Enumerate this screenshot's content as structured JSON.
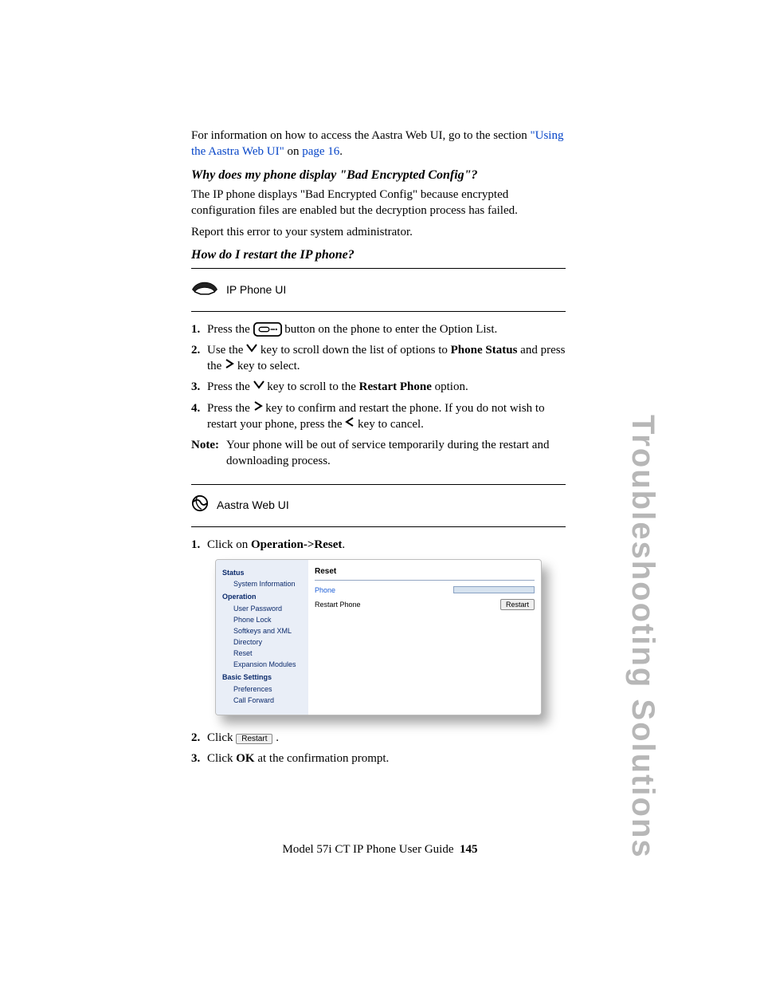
{
  "intro": {
    "text_before_link": "For information on how to access the Aastra Web UI, go to the section ",
    "link_text": "\"Using the Aastra Web UI\"",
    "page_ref_text": " on ",
    "page_ref_link": "page 16",
    "period": "."
  },
  "q1_heading": "Why does my phone display \"Bad Encrypted Config\"?",
  "q1_para": "The IP phone displays \"Bad Encrypted Config\" because encrypted configuration files are enabled but the decryption process has failed.",
  "q1_action": "Report this error to your system administrator.",
  "q2_heading": "How do I restart the IP phone?",
  "ip_phone_ui_label": "IP Phone UI",
  "steps_phone": {
    "s1_a": "Press the ",
    "s1_b": " button on the phone to enter the Option List.",
    "s2_a": "Use the ",
    "s2_b": " key to scroll down the list of options to ",
    "s2_bold": "Phone Status",
    "s2_c": " and press the ",
    "s2_d": " key to select.",
    "s3_a": "Press the ",
    "s3_b": " key to scroll to the ",
    "s3_bold": "Restart Phone",
    "s3_c": " option.",
    "s4_a": "Press the ",
    "s4_b": " key to confirm and restart the phone. If you do not wish to restart your phone, press the ",
    "s4_c": " key to cancel."
  },
  "note_label": "Note:",
  "note_text": " Your phone will be out of service temporarily during the restart and downloading process.",
  "aastra_web_ui_label": "Aastra Web UI",
  "step_web_1_a": "Click on ",
  "step_web_1_bold": "Operation->Reset",
  "step_web_1_b": ".",
  "web_ui": {
    "side": {
      "status": "Status",
      "status_items": [
        "System Information"
      ],
      "operation": "Operation",
      "operation_items": [
        "User Password",
        "Phone Lock",
        "Softkeys and XML",
        "Directory",
        "Reset",
        "Expansion Modules"
      ],
      "basic": "Basic Settings",
      "basic_items": [
        "Preferences",
        "Call Forward"
      ]
    },
    "main_title": "Reset",
    "row_phone": "Phone",
    "row_restart": "Restart Phone",
    "restart_btn": "Restart"
  },
  "step_web_2_a": "Click ",
  "step_web_2_btn": "Restart",
  "step_web_2_b": ".",
  "step_web_3_a": "Click ",
  "step_web_3_bold": "OK",
  "step_web_3_b": " at the confirmation prompt.",
  "side_label": "Troubleshooting Solutions",
  "footer_text": "Model 57i CT IP Phone User Guide",
  "footer_page": "145"
}
